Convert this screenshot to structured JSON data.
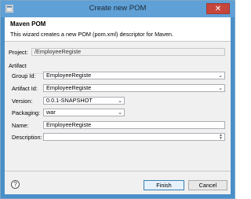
{
  "window": {
    "title": "Create new POM",
    "close_glyph": "✕"
  },
  "banner": {
    "title": "Maven POM",
    "description": "This wizard creates a new POM (pom.xml) descriptor for Maven."
  },
  "form": {
    "project": {
      "label": "Project:",
      "value": "/EmployeeRegiste"
    },
    "artifact_label": "Artifact",
    "group_id": {
      "label": "Group Id:",
      "value": "EmployeeRegiste"
    },
    "artifact_id": {
      "label": "Artifact Id:",
      "value": "EmployeeRegiste"
    },
    "version": {
      "label": "Version:",
      "value": "0.0.1-SNAPSHOT"
    },
    "packaging": {
      "label": "Packaging:",
      "value": "war"
    },
    "name": {
      "label": "Name:",
      "value": "EmployeeRegiste"
    },
    "description": {
      "label": "Description:",
      "value": ""
    }
  },
  "footer": {
    "help_glyph": "?",
    "finish_label": "Finish",
    "cancel_label": "Cancel"
  },
  "icons": {
    "dropdown": "chevron-down-icon"
  },
  "colors": {
    "title_bar": "#5fa0d6",
    "close_button": "#c7463c",
    "primary_border": "#3c7fb1"
  }
}
